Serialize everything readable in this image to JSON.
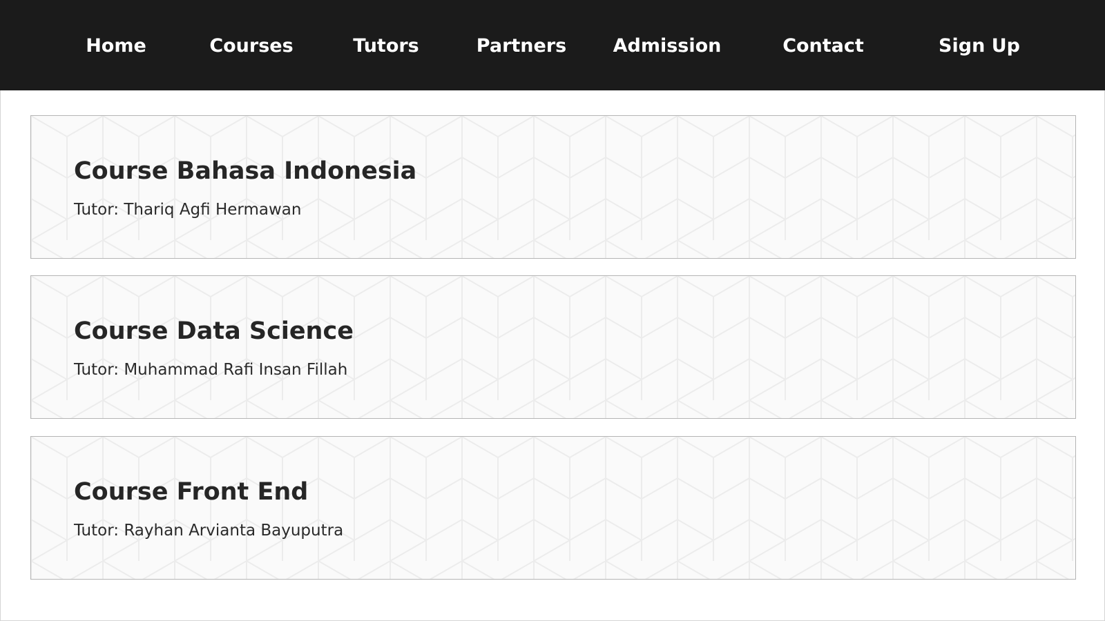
{
  "nav": {
    "items": [
      {
        "label": "Home"
      },
      {
        "label": "Courses"
      },
      {
        "label": "Tutors"
      },
      {
        "label": "Partners"
      },
      {
        "label": "Admission"
      },
      {
        "label": "Contact"
      },
      {
        "label": "Sign Up"
      }
    ]
  },
  "courses": [
    {
      "title": "Course Bahasa Indonesia",
      "tutor": "Tutor: Thariq Agfi Hermawan"
    },
    {
      "title": "Course Data Science",
      "tutor": "Tutor: Muhammad Rafi Insan Fillah"
    },
    {
      "title": "Course Front End",
      "tutor": "Tutor: Rayhan Arvianta Bayuputra"
    }
  ],
  "colors": {
    "navbar_background": "#1b1b1b",
    "nav_text": "#ffffff",
    "card_background": "#fafafa",
    "card_border": "#b4b4b4",
    "pattern_line": "#ececec"
  }
}
